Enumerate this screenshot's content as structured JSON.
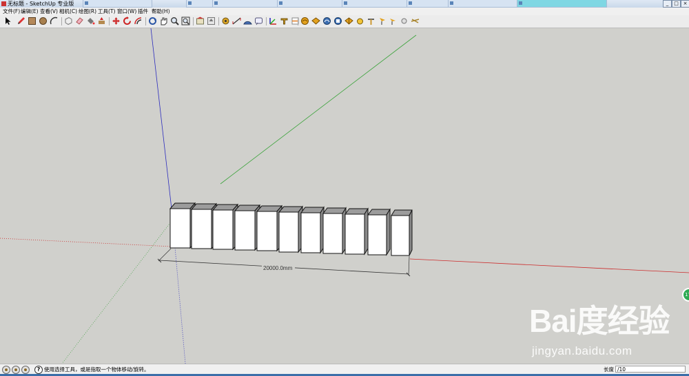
{
  "window": {
    "title": "无标题 - SketchUp 专业版",
    "taskbar_items": [
      "",
      "",
      "",
      "",
      "",
      "",
      "",
      ""
    ]
  },
  "menu": {
    "items": [
      "文件(F)",
      "编辑(E)",
      "查看(V)",
      "相机(C)",
      "绘图(R)",
      "工具(T)",
      "窗口(W)",
      "插件",
      "帮助(H)"
    ]
  },
  "toolbar": {
    "tools": [
      "select-tool",
      "pencil-tool",
      "rectangle-tool",
      "circle-tool",
      "arc-tool",
      "make-component-tool",
      "eraser-tool",
      "paint-bucket-tool",
      "push-pull-tool",
      "follow-me-tool",
      "move-tool",
      "rotate-tool",
      "offset-tool",
      "orbit-tool",
      "pan-tool",
      "zoom-tool",
      "zoom-extents-tool",
      "3d-warehouse-tool",
      "component-upload-tool",
      "tape-measure-tool",
      "dimension-tool",
      "protractor-tool",
      "text-tool",
      "axes-tool",
      "3d-text-tool",
      "sandbox-from-contours-tool",
      "sandbox-from-scratch-tool",
      "smoove-tool",
      "stamp-tool",
      "drape-tool",
      "add-detail-tool",
      "flip-edge-tool",
      "walk-tool",
      "position-camera-tool"
    ]
  },
  "scene": {
    "dimension_label": "20000.0mm",
    "colors": {
      "background": "#d0d0cc",
      "red_axis": "#cc2a2a",
      "green_axis": "#3aa33a",
      "blue_axis": "#2b2bbd",
      "face": "#ffffff",
      "side": "#8a8a8a",
      "top": "#9c9c9c"
    }
  },
  "status": {
    "hint": "使用选择工具，或是指取一个物体移动/旋转。",
    "measure_label": "长度",
    "measure_value": "/10"
  },
  "watermark": {
    "logo": "Bai度经验",
    "url": "jingyan.baidu.com"
  },
  "side_tab": {
    "label": "17"
  }
}
